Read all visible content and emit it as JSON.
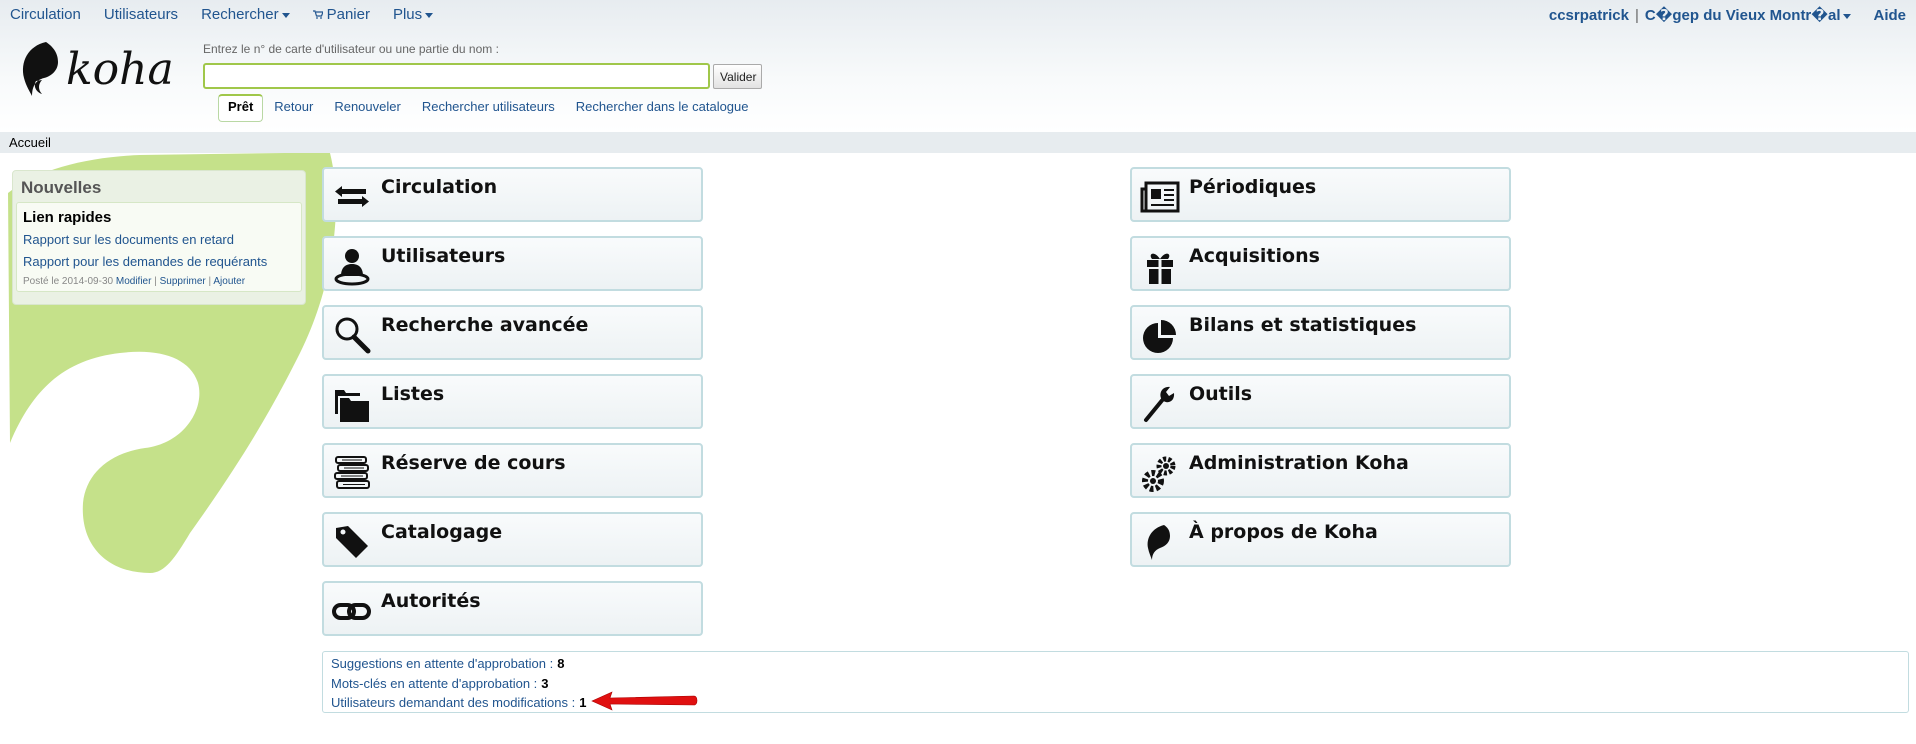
{
  "topnav": {
    "items": [
      {
        "label": "Circulation",
        "dropdown": false
      },
      {
        "label": "Utilisateurs",
        "dropdown": false
      },
      {
        "label": "Rechercher",
        "dropdown": true
      },
      {
        "label": "Panier",
        "dropdown": false
      },
      {
        "label": "Plus",
        "dropdown": true
      }
    ],
    "user": "ccsrpatrick",
    "separator": "|",
    "library": "C�gep du Vieux Montr�al",
    "help": "Aide"
  },
  "logo": {
    "text": "koha"
  },
  "search": {
    "label": "Entrez le n° de carte d'utilisateur ou une partie du nom :",
    "value": "",
    "submit": "Valider",
    "tabs": [
      "Prêt",
      "Retour",
      "Renouveler",
      "Rechercher utilisateurs",
      "Rechercher dans le catalogue"
    ],
    "active_tab": "Prêt"
  },
  "breadcrumb": "Accueil",
  "news": {
    "heading": "Nouvelles",
    "title": "Lien rapides",
    "links": [
      "Rapport sur les documents en retard",
      "Rapport pour les demandes de requérants"
    ],
    "posted": "Posté le 2014-09-30",
    "actions": [
      "Modifier",
      "Supprimer",
      "Ajouter"
    ],
    "action_sep": "|"
  },
  "modules": {
    "left": [
      {
        "label": "Circulation",
        "icon": "circulation-arrows-icon"
      },
      {
        "label": "Utilisateurs",
        "icon": "patron-icon"
      },
      {
        "label": "Recherche avancée",
        "icon": "magnifier-icon"
      },
      {
        "label": "Listes",
        "icon": "folders-icon"
      },
      {
        "label": "Réserve de cours",
        "icon": "books-stack-icon"
      },
      {
        "label": "Catalogage",
        "icon": "tag-icon"
      },
      {
        "label": "Autorités",
        "icon": "chain-link-icon"
      }
    ],
    "right": [
      {
        "label": "Périodiques",
        "icon": "newspaper-icon"
      },
      {
        "label": "Acquisitions",
        "icon": "gift-icon"
      },
      {
        "label": "Bilans et statistiques",
        "icon": "pie-chart-icon"
      },
      {
        "label": "Outils",
        "icon": "wrench-icon"
      },
      {
        "label": "Administration Koha",
        "icon": "gears-icon"
      },
      {
        "label": "À propos de Koha",
        "icon": "koha-leaf-icon"
      }
    ]
  },
  "pending": [
    {
      "label": "Suggestions en attente d'approbation",
      "count": "8"
    },
    {
      "label": "Mots-clés en attente d'approbation",
      "count": "3"
    },
    {
      "label": "Utilisateurs demandant des modifications",
      "count": "1"
    }
  ],
  "colors": {
    "link": "#21558f",
    "accent_green": "#a0c74a",
    "module_border": "#c2dce0",
    "arrow": "#e01010"
  }
}
